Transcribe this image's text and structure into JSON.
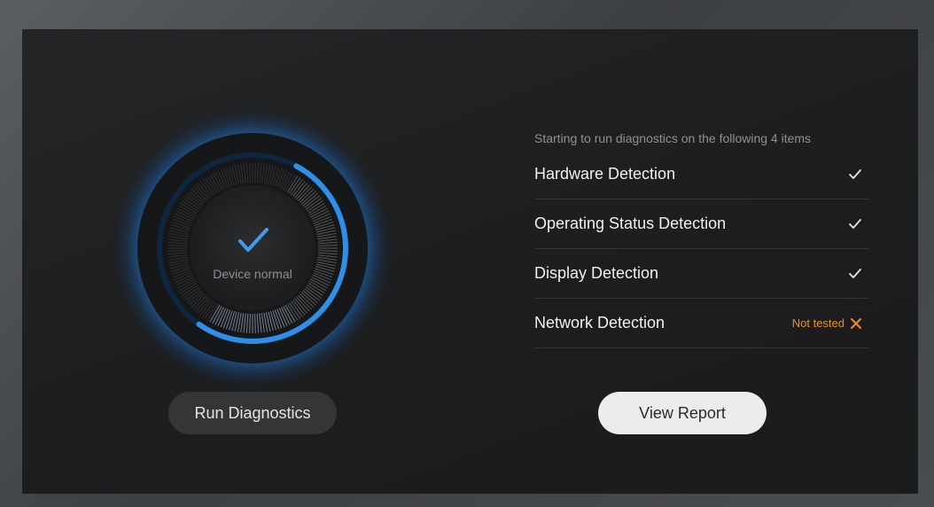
{
  "dial": {
    "status_label": "Device normal",
    "icon": "check-icon",
    "progress": 0.72
  },
  "buttons": {
    "run_label": "Run Diagnostics",
    "report_label": "View Report"
  },
  "checklist": {
    "intro": "Starting to run diagnostics on the following 4 items",
    "items": [
      {
        "label": "Hardware Detection",
        "status": "passed",
        "status_text": "",
        "icon": "check-icon"
      },
      {
        "label": "Operating Status Detection",
        "status": "passed",
        "status_text": "",
        "icon": "check-icon"
      },
      {
        "label": "Display Detection",
        "status": "passed",
        "status_text": "",
        "icon": "check-icon"
      },
      {
        "label": "Network Detection",
        "status": "not-tested",
        "status_text": "Not tested",
        "icon": "close-icon"
      }
    ]
  },
  "colors": {
    "accent": "#2f8fe8",
    "warning": "#f08c24",
    "check": "#e8e8e8"
  }
}
